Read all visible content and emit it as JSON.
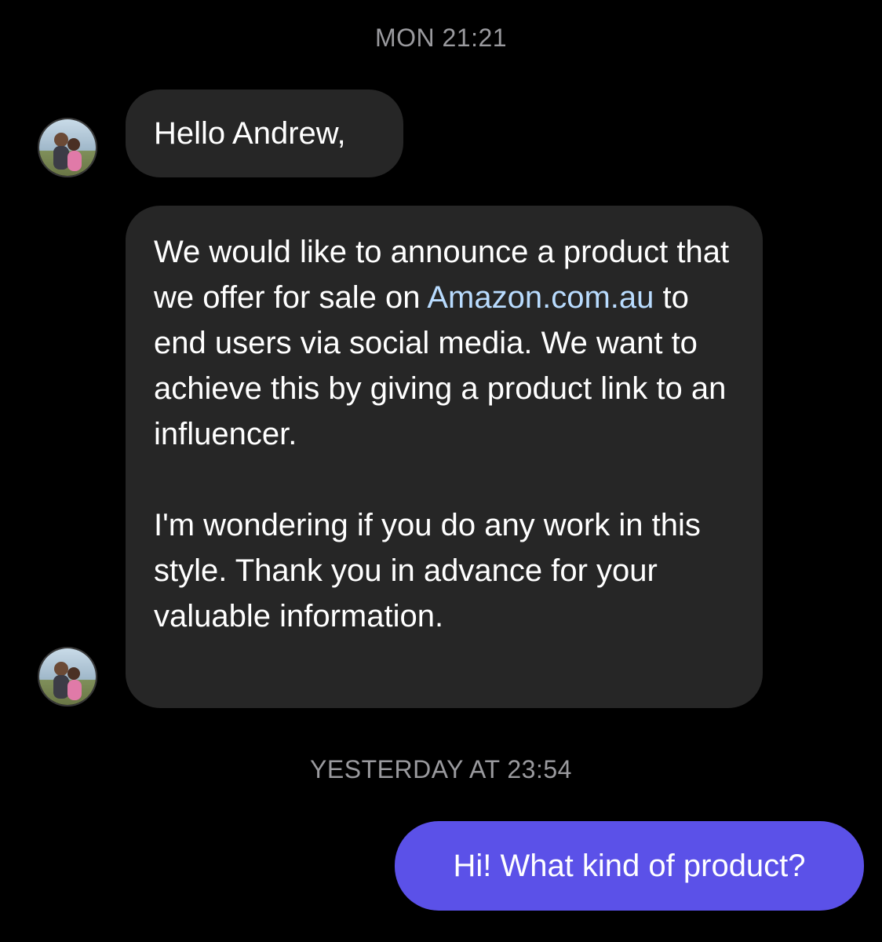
{
  "conversation": {
    "timestamps": [
      "MON 21:21",
      "YESTERDAY AT 23:54"
    ],
    "incoming": {
      "greeting": "Hello Andrew,",
      "body": {
        "line_a": "We would like to announce a product that we offer for sale on ",
        "link": "Amazon.com.au",
        "line_b": " to end users via social media. We want to achieve this by giving a product link to an influencer.",
        "paragraph2": "I'm wondering if you do any work in this style. Thank you in advance for your valuable information."
      }
    },
    "outgoing": {
      "reply": "Hi! What kind of product?"
    }
  },
  "colors": {
    "background": "#000000",
    "incoming_bubble": "#262626",
    "outgoing_bubble": "#5b51e8",
    "link": "#b9dcff",
    "timestamp": "#9a9a9e"
  },
  "icons": {
    "avatar": "profile-photo-avatar"
  }
}
